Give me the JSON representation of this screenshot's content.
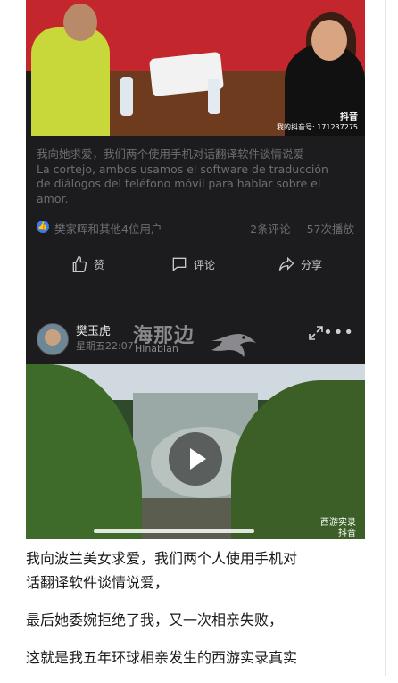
{
  "post1": {
    "video_watermark": {
      "brand": "抖音",
      "account": "我的抖音号: 171237275"
    },
    "caption": {
      "zh": "我向她求爱，我们两个使用手机对话翻译软件谈情说爱",
      "es_lines": [
        "La cortejo, ambos usamos el software de traducción",
        "de diálogos del teléfono móvil para hablar sobre el",
        "amor."
      ]
    },
    "likers": "樊家晖和其他4位用户",
    "comments_count": "2条评论",
    "plays_count": "57次播放",
    "actions": {
      "like": "赞",
      "comment": "评论",
      "share": "分享"
    }
  },
  "post2": {
    "username": "樊玉虎",
    "time": "星期五22:07",
    "watermark_brand": "海那边",
    "watermark_brand_en": "Hinabian",
    "video_watermark": {
      "line1": "西游实录",
      "line2": "抖音"
    }
  },
  "article": {
    "p1_line1": "我向波兰美女求爱，我们两个人使用手机对",
    "p1_line2": "话翻译软件谈情说爱，",
    "p2": "最后她委婉拒绝了我，又一次相亲失败，",
    "p3": "这就是我五年环球相亲发生的西游实录真实"
  },
  "colors": {
    "card_bg": "#1c1c1e",
    "muted_text": "#6e6e72",
    "accent_blue": "#3e7be6"
  }
}
